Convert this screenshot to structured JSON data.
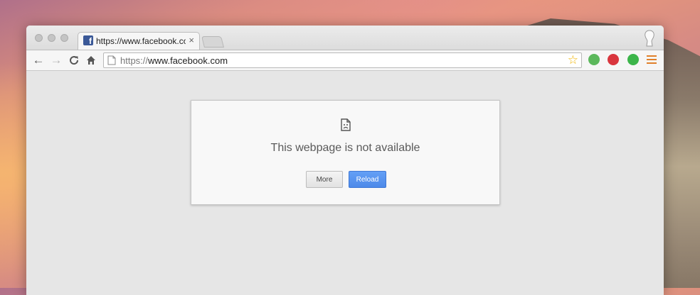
{
  "tab": {
    "title": "https://www.facebook.com",
    "favicon": "facebook-icon",
    "close_glyph": "×"
  },
  "toolbar": {
    "back_glyph": "←",
    "forward_glyph": "→",
    "reload_glyph": "C",
    "home_glyph": "⌂",
    "url_scheme": "https://",
    "url_host": "www.facebook.com",
    "star_glyph": "☆"
  },
  "error": {
    "title": "This webpage is not available",
    "more_label": "More",
    "reload_label": "Reload"
  },
  "colors": {
    "reload_button": "#4d8ae9",
    "bookmark_star": "#f0b400",
    "facebook_blue": "#3b5998"
  }
}
